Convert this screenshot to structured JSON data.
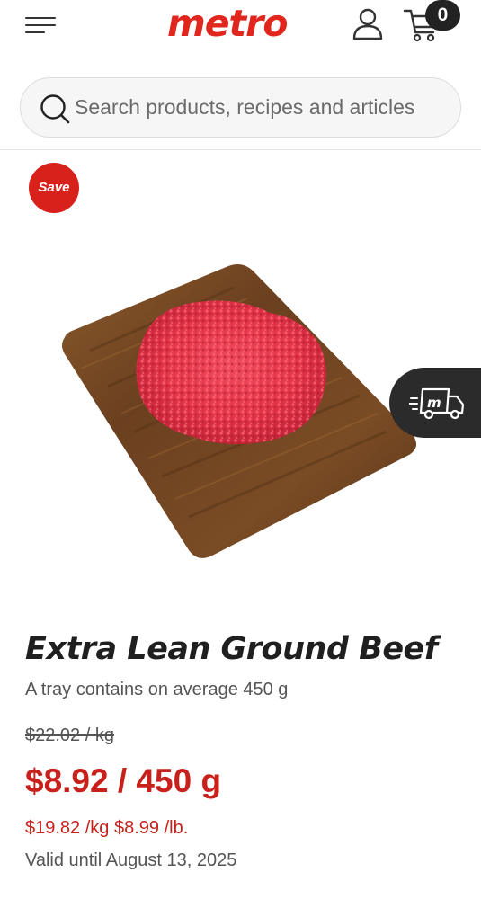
{
  "header": {
    "menu_icon": "hamburger-menu-icon",
    "logo": "metro",
    "account_icon": "user-icon",
    "cart_icon": "shopping-cart-icon",
    "cart_count": "0"
  },
  "search": {
    "placeholder": "Search products, recipes and articles",
    "icon": "search-icon"
  },
  "product": {
    "badge": "Save",
    "title": "Extra Lean Ground Beef",
    "subtitle": "A tray contains on average 450 g",
    "regular_price": "$22.02 / kg",
    "sale_price": "$8.92 / 450 g",
    "unit_prices": "$19.82 /kg $8.99 /lb.",
    "valid_until": "Valid until August 13, 2025"
  },
  "delivery_icon": "delivery-truck-icon",
  "colors": {
    "brand_red": "#e0261d",
    "price_red": "#c8211b",
    "dark": "#2b2b2b"
  }
}
